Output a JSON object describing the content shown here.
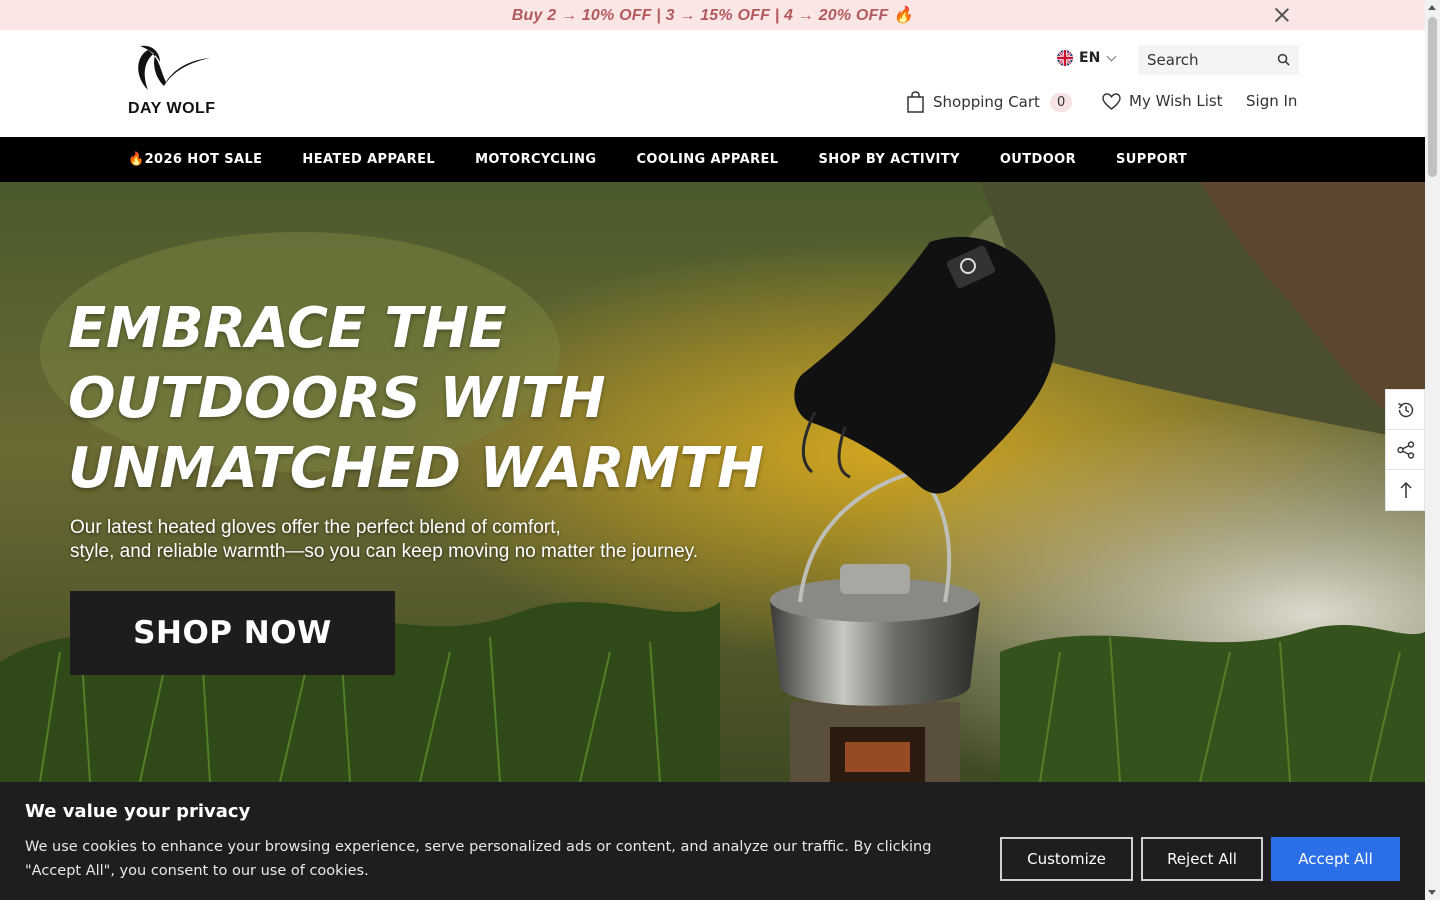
{
  "announcement": {
    "text": "Buy 2 → 10% OFF | 3 → 15% OFF | 4 → 20% OFF 🔥"
  },
  "header": {
    "logo_text": "DAY WOLF",
    "language": "EN",
    "search_placeholder": "Search",
    "cart_label": "Shopping Cart",
    "cart_count": "0",
    "wishlist_label": "My Wish List",
    "signin_label": "Sign In"
  },
  "nav": {
    "items": [
      {
        "label": "🔥2026 HOT SALE"
      },
      {
        "label": "HEATED APPAREL"
      },
      {
        "label": "MOTORCYCLING"
      },
      {
        "label": "COOLING APPAREL"
      },
      {
        "label": "SHOP BY ACTIVITY"
      },
      {
        "label": "OUTDOOR"
      },
      {
        "label": "SUPPORT"
      }
    ]
  },
  "hero": {
    "title_line1": "EMBRACE THE",
    "title_line2": "OUTDOORS WITH",
    "title_line3": "UNMATCHED WARMTH",
    "subtitle_line1": "Our latest heated gloves offer the perfect blend of comfort,",
    "subtitle_line2": "style, and reliable warmth—so you can keep moving no matter the journey.",
    "cta": "SHOP NOW"
  },
  "tools": {
    "icons": [
      "history-icon",
      "share-icon",
      "back-to-top-icon"
    ]
  },
  "cookie": {
    "title": "We value your privacy",
    "text": "We use cookies to enhance your browsing experience, serve personalized ads or content, and analyze our traffic. By clicking \"Accept All\", you consent to our use of cookies.",
    "customize": "Customize",
    "reject": "Reject All",
    "accept": "Accept All"
  },
  "colors": {
    "announcement_bg": "#fbe6e6",
    "announcement_text": "#b35a5f",
    "nav_bg": "#000000",
    "accept_button": "#2a6ee8",
    "cookie_bg": "#1e1e20"
  }
}
